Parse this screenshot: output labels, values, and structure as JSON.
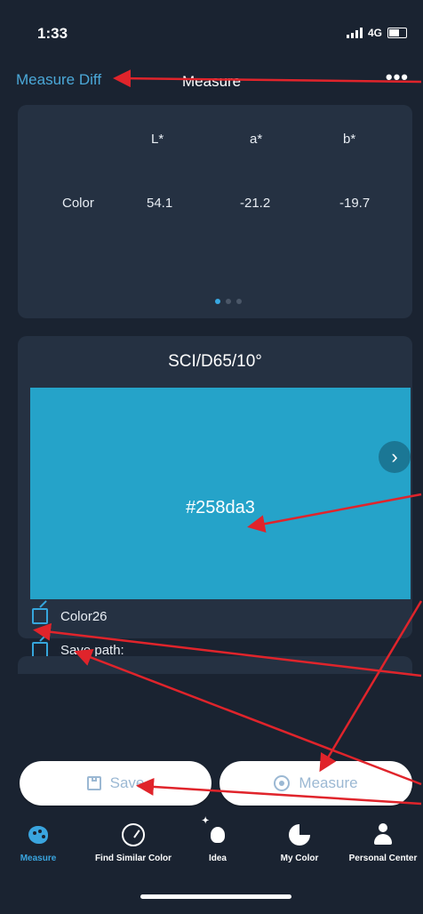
{
  "status_bar": {
    "time": "1:33",
    "network": "4G"
  },
  "nav": {
    "left_link": "Measure Diff",
    "title": "Measure",
    "more": "•••"
  },
  "lab_card": {
    "headers": [
      "L*",
      "a*",
      "b*"
    ],
    "row_label": "Color",
    "values": [
      "54.1",
      "-21.2",
      "-19.7"
    ],
    "page_count": 3,
    "active_page": 1
  },
  "color_card": {
    "condition": "SCI/D65/10°",
    "hex": "#258da3",
    "swatch_color": "#25a3c9",
    "next_glyph": "›",
    "name_label": "Color26",
    "save_path_label": "Save path:"
  },
  "actions": {
    "save_label": "Save",
    "measure_label": "Measure"
  },
  "tabs": [
    {
      "label": "Measure",
      "icon": "palette-icon",
      "active": true
    },
    {
      "label": "Find Similar Color",
      "icon": "gauge-icon",
      "active": false
    },
    {
      "label": "Idea",
      "icon": "lightbulb-icon",
      "active": false
    },
    {
      "label": "My Color",
      "icon": "pie-chart-icon",
      "active": false
    },
    {
      "label": "Personal Center",
      "icon": "person-icon",
      "active": false
    }
  ],
  "colors": {
    "background": "#1a2331",
    "card": "#253142",
    "accent": "#3aa5df",
    "annotation": "#e0242b"
  }
}
